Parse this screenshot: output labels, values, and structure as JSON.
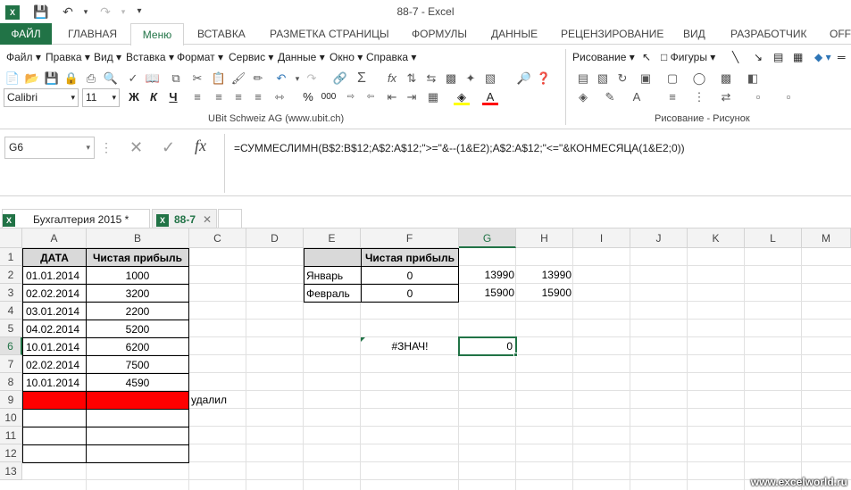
{
  "window": {
    "title": "88-7 - Excel"
  },
  "tabs": [
    {
      "id": "file",
      "label": "ФАЙЛ"
    },
    {
      "id": "home",
      "label": "ГЛАВНАЯ"
    },
    {
      "id": "menu",
      "label": "Меню"
    },
    {
      "id": "insert",
      "label": "ВСТАВКА"
    },
    {
      "id": "layout",
      "label": "РАЗМЕТКА СТРАНИЦЫ"
    },
    {
      "id": "formulas",
      "label": "ФОРМУЛЫ"
    },
    {
      "id": "data",
      "label": "ДАННЫЕ"
    },
    {
      "id": "review",
      "label": "РЕЦЕНЗИРОВАНИЕ"
    },
    {
      "id": "view",
      "label": "ВИД"
    },
    {
      "id": "dev",
      "label": "РАЗРАБОТЧИК"
    },
    {
      "id": "office",
      "label": "OFF"
    }
  ],
  "menubar": [
    "Файл",
    "Правка",
    "Вид",
    "Вставка",
    "Формат",
    "Сервис",
    "Данные",
    "Окно",
    "Справка"
  ],
  "drawing": {
    "draw_label": "Рисование",
    "shapes_label": "Фигуры"
  },
  "font": {
    "name": "Calibri",
    "size": "11"
  },
  "format_buttons": {
    "bold": "Ж",
    "italic": "К",
    "underline": "Ч",
    "percent": "%",
    "comma": "000"
  },
  "captions": {
    "ubit": "UBit Schweiz AG   (www.ubit.ch)",
    "drawing": "Рисование - Рисунок"
  },
  "formulabar": {
    "name_box": "G6",
    "fx": "fx",
    "formula": "=СУММЕСЛИМН(B$2:B$12;A$2:A$12;\">=\"&--(1&E2);A$2:A$12;\"<=\"&КОНМЕСЯЦА(1&E2;0))"
  },
  "workbooks": [
    {
      "label": "Бухгалтерия 2015 *"
    },
    {
      "label": "88-7"
    }
  ],
  "columns": [
    "A",
    "B",
    "C",
    "D",
    "E",
    "F",
    "G",
    "H",
    "I",
    "J",
    "K",
    "L",
    "M"
  ],
  "rows": [
    "1",
    "2",
    "3",
    "4",
    "5",
    "6",
    "7",
    "8",
    "9",
    "10",
    "11",
    "12",
    "13"
  ],
  "table1": {
    "header_date": "ДАТА",
    "header_profit": "Чистая прибыль",
    "rows": [
      {
        "date": "01.01.2014",
        "value": "1000"
      },
      {
        "date": "02.02.2014",
        "value": "3200"
      },
      {
        "date": "03.01.2014",
        "value": "2200"
      },
      {
        "date": "04.02.2014",
        "value": "5200"
      },
      {
        "date": "10.01.2014",
        "value": "6200"
      },
      {
        "date": "02.02.2014",
        "value": "7500"
      },
      {
        "date": "10.01.2014",
        "value": "4590"
      }
    ],
    "deleted_note": "удалил"
  },
  "table2": {
    "header_profit": "Чистая прибыль",
    "rows": [
      {
        "month": "Январь",
        "f": "0",
        "g": "13990",
        "h": "13990"
      },
      {
        "month": "Февраль",
        "f": "0",
        "g": "15900",
        "h": "15900"
      }
    ]
  },
  "f6": "#ЗНАЧ!",
  "g6": "0",
  "colors": {
    "accent": "#217346",
    "red_fill": "#ff0000",
    "header_fill": "#d9d9d9"
  },
  "watermark": "www.excelworld.ru"
}
